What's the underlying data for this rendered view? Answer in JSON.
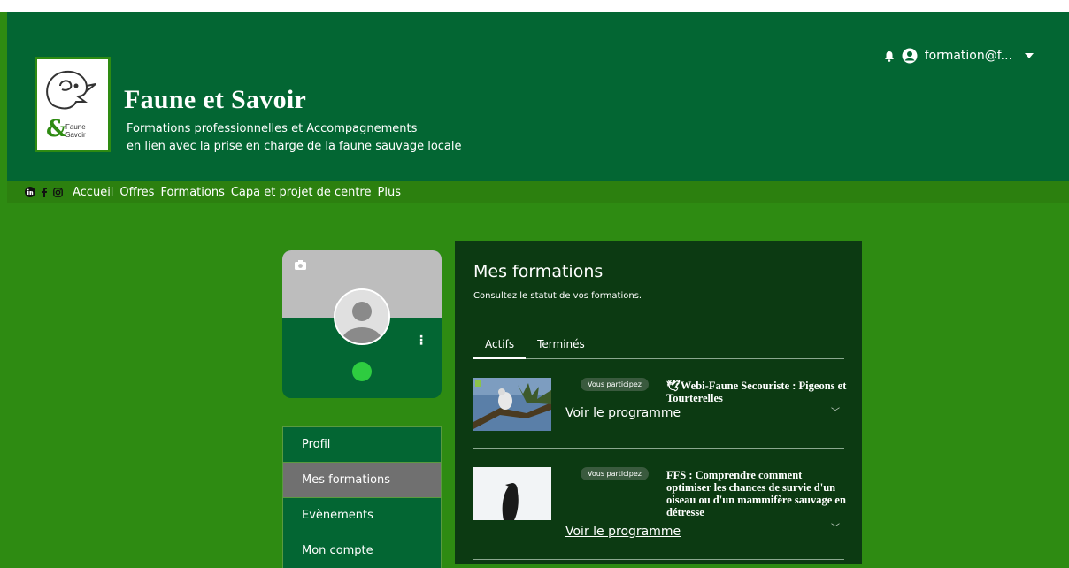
{
  "header": {
    "site_title": "Faune et Savoir",
    "subtitle_line1": "Formations professionnelles et Accompagnements",
    "subtitle_line2": "en lien avec la prise en charge de la faune sauvage locale",
    "logo_text_line1": "Faune",
    "logo_text_line2": "Savoir",
    "logo_amp": "&",
    "user_label": "formation@f..."
  },
  "nav": {
    "items": [
      "Accueil",
      "Offres",
      "Formations",
      "Capa et projet de centre",
      "Plus"
    ]
  },
  "sidebar": {
    "items": [
      {
        "label": "Profil"
      },
      {
        "label": "Mes formations"
      },
      {
        "label": "Evènements"
      },
      {
        "label": "Mon compte"
      }
    ]
  },
  "main": {
    "title": "Mes formations",
    "description": "Consultez le statut de vos formations.",
    "tabs": [
      "Actifs",
      "Terminés"
    ],
    "courses": [
      {
        "badge": "Vous participez",
        "title": "Webi-Faune Secouriste : Pigeons et Tourterelles",
        "link": "Voir le programme"
      },
      {
        "badge": "Vous participez",
        "title": "FFS : Comprendre comment optimiser les chances de survie d'un oiseau ou d'un mammifère sauvage en détresse",
        "link": "Voir le programme"
      }
    ]
  },
  "colors": {
    "header_bg": "#036633",
    "page_bg": "#2e8b12",
    "panel_bg": "#0c3a12",
    "active_menu": "#707070"
  }
}
